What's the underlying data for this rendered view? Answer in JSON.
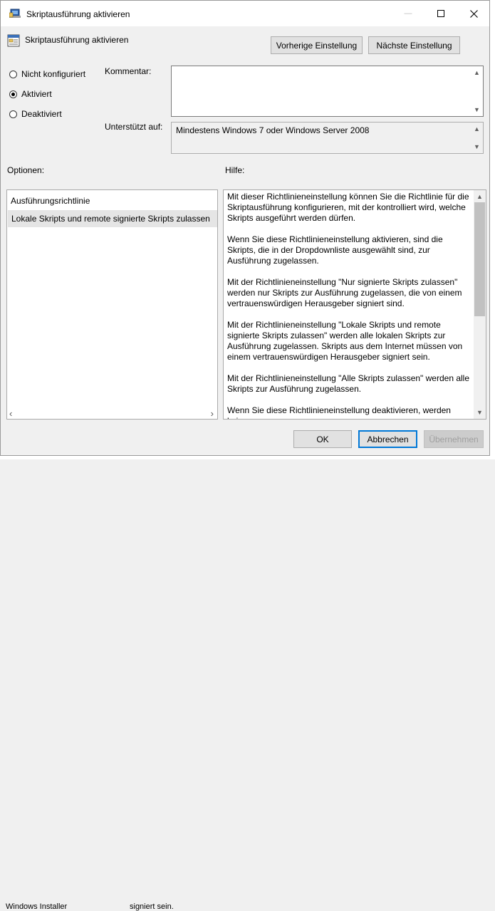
{
  "window": {
    "title": "Skriptausführung aktivieren",
    "minimize_glyph": "—",
    "maximize_glyph": "☐",
    "close_glyph": "✕"
  },
  "header": {
    "title": "Skriptausführung aktivieren",
    "prev_button": "Vorherige Einstellung",
    "next_button": "Nächste Einstellung"
  },
  "state": {
    "options": [
      "Nicht konfiguriert",
      "Aktiviert",
      "Deaktiviert"
    ],
    "selected": "Aktiviert"
  },
  "comment": {
    "label": "Kommentar:",
    "value": ""
  },
  "supported": {
    "label": "Unterstützt auf:",
    "value": "Mindestens Windows 7 oder Windows Server 2008"
  },
  "options_section": {
    "label": "Optionen:",
    "field_label": "Ausführungsrichtlinie",
    "selected_value": "Lokale Skripts und remote signierte Skripts zulassen"
  },
  "help_section": {
    "label": "Hilfe:",
    "paragraphs": [
      "Mit dieser Richtlinieneinstellung können Sie die Richtlinie für die Skriptausführung konfigurieren, mit der kontrolliert wird, welche Skripts ausgeführt werden dürfen.",
      "Wenn Sie diese Richtlinieneinstellung aktivieren, sind die Skripts, die in der Dropdownliste ausgewählt sind, zur Ausführung zugelassen.",
      "Mit der Richtlinieneinstellung \"Nur signierte Skripts zulassen\" werden nur Skripts zur Ausführung zugelassen, die von einem vertrauenswürdigen Herausgeber signiert sind.",
      "Mit der Richtlinieneinstellung \"Lokale Skripts und remote signierte Skripts zulassen\" werden alle lokalen Skripts zur Ausführung zugelassen. Skripts aus dem Internet müssen von einem vertrauenswürdigen Herausgeber signiert sein.",
      "Mit der Richtlinieneinstellung \"Alle Skripts zulassen\" werden alle Skripts zur Ausführung zugelassen.",
      "Wenn Sie diese Richtlinieneinstellung deaktivieren, werden keine"
    ]
  },
  "footer": {
    "ok": "OK",
    "cancel": "Abbrechen",
    "apply": "Übernehmen"
  },
  "background": {
    "bottom_left": "Windows Installer",
    "bottom_mid": "signiert sein."
  },
  "colors": {
    "accent": "#0078d7",
    "dialog_bg": "#f0f0f0",
    "selection_bg": "#e5e5e5"
  }
}
